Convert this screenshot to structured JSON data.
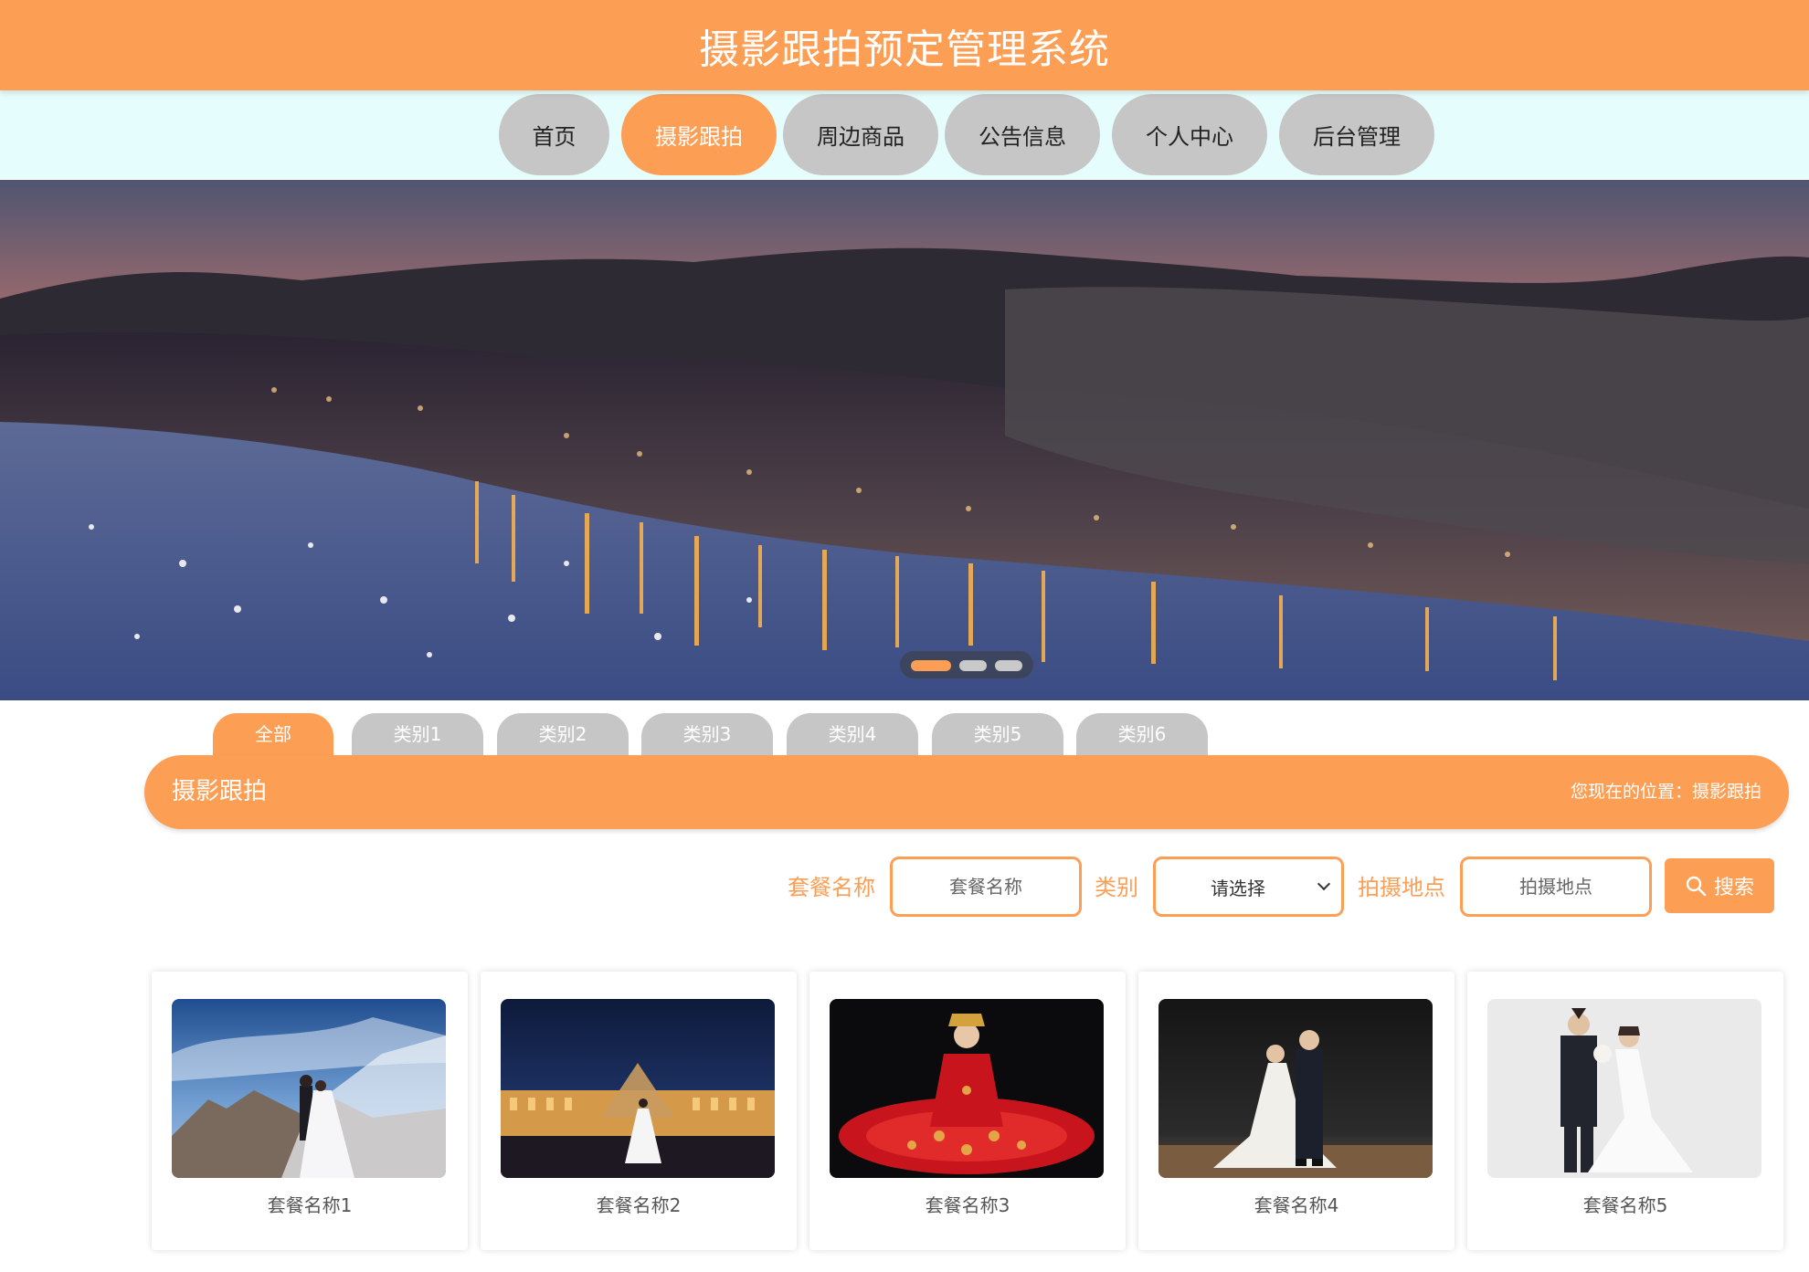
{
  "header": {
    "title": "摄影跟拍预定管理系统"
  },
  "nav": {
    "items": [
      {
        "label": "首页",
        "active": false
      },
      {
        "label": "摄影跟拍",
        "active": true
      },
      {
        "label": "周边商品",
        "active": false
      },
      {
        "label": "公告信息",
        "active": false
      },
      {
        "label": "个人中心",
        "active": false
      },
      {
        "label": "后台管理",
        "active": false
      }
    ]
  },
  "banner": {
    "slide_count": 3,
    "active_slide": 1
  },
  "categories": {
    "tabs": [
      {
        "label": "全部",
        "active": true
      },
      {
        "label": "类别1",
        "active": false
      },
      {
        "label": "类别2",
        "active": false
      },
      {
        "label": "类别3",
        "active": false
      },
      {
        "label": "类别4",
        "active": false
      },
      {
        "label": "类别5",
        "active": false
      },
      {
        "label": "类别6",
        "active": false
      }
    ]
  },
  "section": {
    "title": "摄影跟拍",
    "breadcrumb": "您现在的位置：摄影跟拍"
  },
  "search": {
    "name_label": "套餐名称",
    "name_placeholder": "套餐名称",
    "category_label": "类别",
    "category_selected": "请选择",
    "location_label": "拍摄地点",
    "location_placeholder": "拍摄地点",
    "button_label": "搜索",
    "button_icon": "search-icon"
  },
  "packages": [
    {
      "name": "套餐名称1"
    },
    {
      "name": "套餐名称2"
    },
    {
      "name": "套餐名称3"
    },
    {
      "name": "套餐名称4"
    },
    {
      "name": "套餐名称5"
    }
  ],
  "colors": {
    "accent": "#fd9e55",
    "tab_inactive": "#c6c6c6",
    "nav_background": "#e6fdfd"
  }
}
